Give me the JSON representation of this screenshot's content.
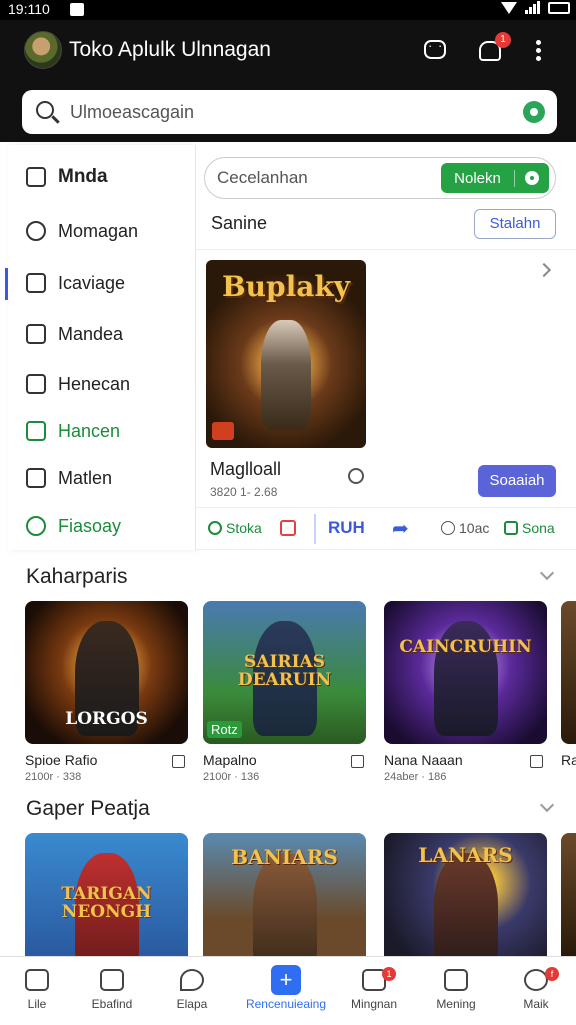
{
  "status_bar": {
    "time": "19:110"
  },
  "header": {
    "title": "Toko Aplulk Ulnnagan",
    "notification_count": "1"
  },
  "search": {
    "placeholder": "Ulmoeascagain"
  },
  "sidebar": {
    "items": [
      {
        "label": "Mnda"
      },
      {
        "label": "Momagan"
      },
      {
        "label": "Icaviage"
      },
      {
        "label": "Mandea"
      },
      {
        "label": "Henecan"
      },
      {
        "label": "Hancen"
      },
      {
        "label": "Matlen"
      },
      {
        "label": "Fiasoay"
      }
    ]
  },
  "panel": {
    "search_placeholder": "Cecelanhan",
    "search_button": "Nolekn",
    "section_label": "Sanine",
    "section_button": "Stalahn",
    "featured": {
      "cover_title": "Buplaky",
      "name": "Maglloall",
      "meta": "3820 1- 2.68",
      "action_button": "Soaaiah"
    },
    "actions": {
      "a1": "Stoka",
      "a3": "RUH",
      "a5": "10ac",
      "a6": "Sona"
    }
  },
  "rows": [
    {
      "title": "Kaharparis",
      "tiles": [
        {
          "logo": "LORGOS",
          "name": "Spioe Rafio",
          "meta": "2100r · 338",
          "badge": ""
        },
        {
          "logo": "SAIRIAS DEARUIN",
          "name": "Mapalno",
          "meta": "2100r · 136",
          "badge": "Rotz"
        },
        {
          "logo": "CAINCRUHIN",
          "name": "Nana Naaan",
          "meta": "24aber · 186",
          "badge": ""
        },
        {
          "logo": "",
          "name": "Ra",
          "meta": "",
          "badge": ""
        }
      ]
    },
    {
      "title": "Gaper Peatja",
      "tiles": [
        {
          "logo": "TARIGAN NEONGH"
        },
        {
          "logo": "BANIARS"
        },
        {
          "logo": "LANARS"
        },
        {
          "logo": ""
        }
      ]
    }
  ],
  "bottom_nav": [
    {
      "label": "Lile",
      "icon": "home-icon",
      "badge": ""
    },
    {
      "label": "Ebafind",
      "icon": "grid-icon",
      "badge": ""
    },
    {
      "label": "Elapa",
      "icon": "leaf-icon",
      "badge": ""
    },
    {
      "label": "Rencenuieaing",
      "icon": "plus-icon",
      "badge": ""
    },
    {
      "label": "Mingnan",
      "icon": "inbox-icon",
      "badge": "1"
    },
    {
      "label": "Mening",
      "icon": "apps-icon",
      "badge": ""
    },
    {
      "label": "Maik",
      "icon": "chat-icon",
      "badge": "f"
    }
  ],
  "colors": {
    "accent_green": "#25a244",
    "accent_blue": "#5b63d9",
    "nav_active": "#2f6ef2",
    "badge_red": "#e53935"
  }
}
